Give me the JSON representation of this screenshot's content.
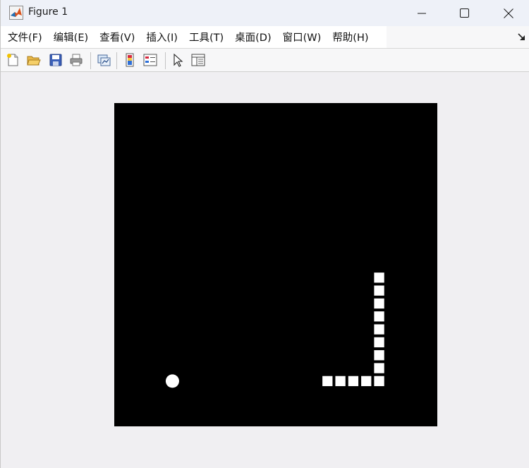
{
  "window": {
    "title": "Figure 1"
  },
  "menu": {
    "items": [
      {
        "id": "file",
        "label": "文件(F)"
      },
      {
        "id": "edit",
        "label": "编辑(E)"
      },
      {
        "id": "view",
        "label": "查看(V)"
      },
      {
        "id": "insert",
        "label": "插入(I)"
      },
      {
        "id": "tools",
        "label": "工具(T)"
      },
      {
        "id": "desktop",
        "label": "桌面(D)"
      },
      {
        "id": "window",
        "label": "窗口(W)"
      },
      {
        "id": "help",
        "label": "帮助(H)"
      }
    ]
  },
  "toolbar": {
    "icons": [
      "new-figure-icon",
      "open-file-icon",
      "save-icon",
      "print-icon",
      "link-plot-icon",
      "colorbar-icon",
      "legend-icon",
      "pointer-icon",
      "property-inspector-icon"
    ]
  },
  "game": {
    "grid_size": 25,
    "background": "#000000",
    "piece_color": "#ffffff",
    "snake": [
      [
        16,
        3
      ],
      [
        17,
        3
      ],
      [
        18,
        3
      ],
      [
        19,
        3
      ],
      [
        20,
        3
      ],
      [
        20,
        4
      ],
      [
        20,
        5
      ],
      [
        20,
        6
      ],
      [
        20,
        7
      ],
      [
        20,
        8
      ],
      [
        20,
        9
      ],
      [
        20,
        10
      ],
      [
        20,
        11
      ]
    ],
    "food": [
      4,
      3
    ]
  }
}
